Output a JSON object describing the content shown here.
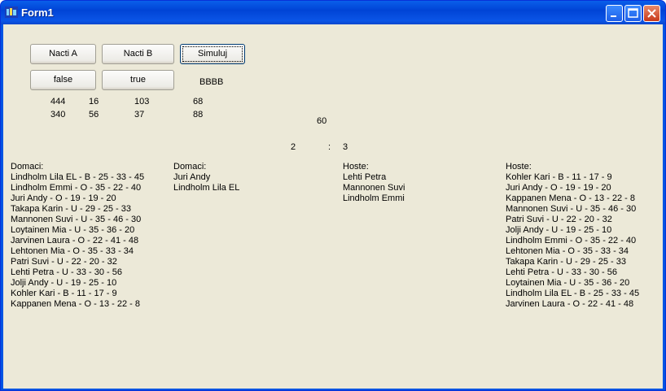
{
  "window": {
    "title": "Form1"
  },
  "buttons": {
    "nacti_a": "Nacti A",
    "nacti_b": "Nacti B",
    "simuluj": "Simuluj",
    "false_btn": "false",
    "true_btn": "true"
  },
  "labels": {
    "bbbb": "BBBB",
    "r1c1": "444",
    "r1c2": "16",
    "r1c3": "103",
    "r1c4": "68",
    "r2c1": "340",
    "r2c2": "56",
    "r2c3": "37",
    "r2c4": "88",
    "sixty": "60",
    "score_home": "2",
    "score_sep": ":",
    "score_away": "3"
  },
  "lists": {
    "domaci_all": {
      "header": "Domaci:",
      "items": [
        "Lindholm Lila EL - B - 25 - 33 - 45",
        "Lindholm Emmi - O - 35 - 22 - 40",
        "Juri Andy - O - 19 - 19 - 20",
        "Takapa Karin - U - 29 - 25 - 33",
        "Mannonen Suvi - U - 35 - 46 - 30",
        "Loytainen Mia - U - 35 - 36 - 20",
        "Jarvinen Laura - O - 22 - 41 - 48",
        "Lehtonen Mia - O - 35 - 33 - 34",
        "Patri Suvi - U - 22 - 20 - 32",
        "Lehti Petra - U - 33 - 30 - 56",
        "Jolji Andy - U - 19 - 25 - 10",
        "Kohler Kari - B - 11 - 17 - 9",
        "Kappanen Mena - O - 13 - 22 - 8"
      ]
    },
    "domaci_sel": {
      "header": "Domaci:",
      "items": [
        "Juri Andy",
        "Lindholm Lila EL"
      ]
    },
    "hoste_sel": {
      "header": "Hoste:",
      "items": [
        "Lehti Petra",
        "Mannonen Suvi",
        "Lindholm Emmi"
      ]
    },
    "hoste_all": {
      "header": "Hoste:",
      "items": [
        "Kohler Kari - B - 11 - 17 - 9",
        "Juri Andy - O - 19 - 19 - 20",
        "Kappanen Mena - O - 13 - 22 - 8",
        "Mannonen Suvi - U - 35 - 46 - 30",
        "Patri Suvi - U - 22 - 20 - 32",
        "Jolji Andy - U - 19 - 25 - 10",
        "Lindholm Emmi - O - 35 - 22 - 40",
        "Lehtonen Mia - O - 35 - 33 - 34",
        "Takapa Karin - U - 29 - 25 - 33",
        "Lehti Petra - U - 33 - 30 - 56",
        "Loytainen Mia - U - 35 - 36 - 20",
        "Lindholm Lila EL - B - 25 - 33 - 45",
        "Jarvinen Laura - O - 22 - 41 - 48"
      ]
    }
  }
}
